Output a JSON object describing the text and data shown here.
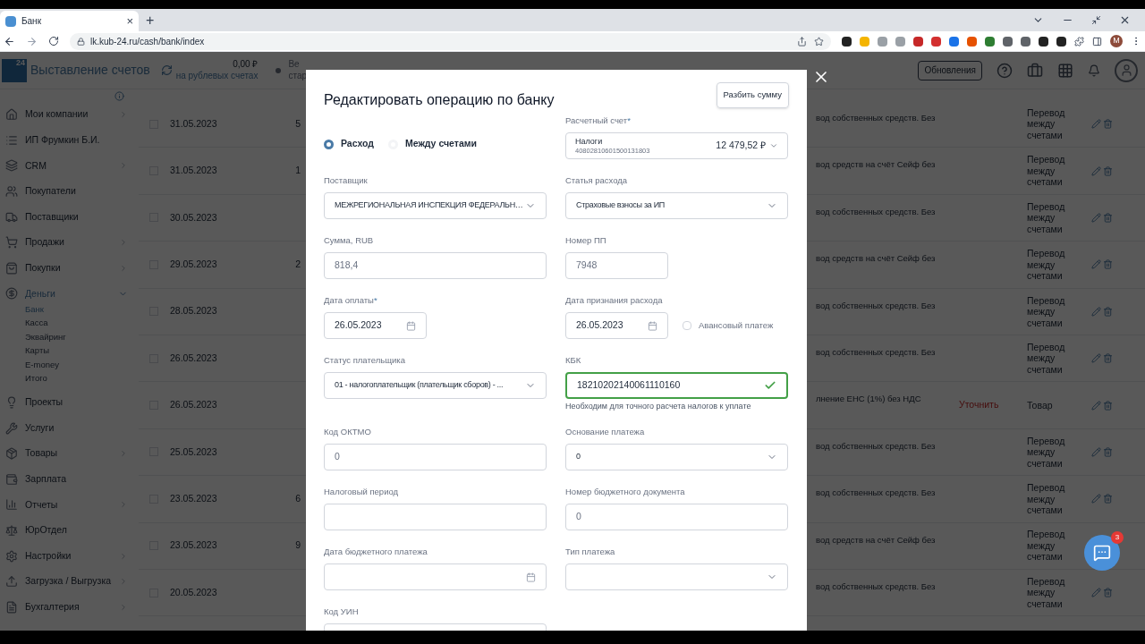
{
  "browser": {
    "tab_title": "Банк",
    "tab_close": "×",
    "new_tab": "+",
    "url": "lk.kub-24.ru/cash/bank/index",
    "profile_letter": "M"
  },
  "header": {
    "logo": "24",
    "title": "Выставление счетов",
    "balance": "0,00 ₽",
    "balance_caption": "на рублевых счетах",
    "cut_line_1": "Ве",
    "cut_line_2": "стар",
    "updates_button": "Обновления"
  },
  "sidebar": {
    "items": [
      {
        "label": "Мои компании",
        "expanded": false
      },
      {
        "label": "ИП Фрумкин Б.И."
      },
      {
        "label": "CRM",
        "expanded": false
      },
      {
        "label": "Покупатели"
      },
      {
        "label": "Поставщики"
      },
      {
        "label": "Продажи",
        "expanded": false
      },
      {
        "label": "Покупки",
        "expanded": false
      },
      {
        "label": "Деньги",
        "expanded": true,
        "children": [
          {
            "label": "Банк",
            "selected": true
          },
          {
            "label": "Касса",
            "selected": false
          },
          {
            "label": "Эквайринг",
            "selected": false
          },
          {
            "label": "Карты",
            "selected": false
          },
          {
            "label": "E-money",
            "selected": false
          },
          {
            "label": "Итого",
            "selected": false
          }
        ]
      },
      {
        "label": "Проекты"
      },
      {
        "label": "Услуги"
      },
      {
        "label": "Товары",
        "expanded": false
      },
      {
        "label": "Зарплата"
      },
      {
        "label": "Отчеты",
        "expanded": false
      },
      {
        "label": "ЮрОтдел"
      },
      {
        "label": "Настройки",
        "expanded": false
      },
      {
        "label": "Загрузка / Выгрузка",
        "expanded": false
      },
      {
        "label": "Бухгалтерия",
        "expanded": false
      }
    ]
  },
  "table": {
    "rows": [
      {
        "checked": false,
        "date": "31.05.2023",
        "amount": "5",
        "description": "вод собственных средств. Без",
        "type": "Перевод между счетами"
      },
      {
        "checked": false,
        "date": "31.05.2023",
        "amount": "1",
        "description": "вод средств на счёт Сейф без",
        "type": "Перевод между счетами"
      },
      {
        "checked": false,
        "date": "30.05.2023",
        "description": "вод собственных средств. Без",
        "type": "Перевод между счетами"
      },
      {
        "checked": false,
        "date": "29.05.2023",
        "amount": "2",
        "description": "вод средств на счёт Сейф без",
        "type": "Перевод между счетами"
      },
      {
        "checked": false,
        "date": "28.05.2023",
        "description": "вод собственных средств. Без",
        "type": "Перевод между счетами"
      },
      {
        "checked": false,
        "date": "26.05.2023",
        "description": "вод собственных средств. Без",
        "type": "Перевод между счетами"
      },
      {
        "checked": false,
        "date": "26.05.2023",
        "description": "лнение ЕНС (1%) без НДС",
        "column_5": "Уточнить",
        "type": "Товар"
      },
      {
        "checked": false,
        "date": "25.05.2023",
        "description": "вод собственных средств. Без",
        "type": "Перевод между счетами"
      },
      {
        "checked": false,
        "date": "23.05.2023",
        "amount": "6",
        "description": "вод собственных средств. Без",
        "type": "Перевод между счетами"
      },
      {
        "checked": false,
        "date": "23.05.2023",
        "amount": "9",
        "description": "вод средств на счёт Сейф без",
        "type": "Перевод между счетами"
      },
      {
        "checked": false,
        "date": "20.05.2023",
        "description": "вод собственных средств. Без",
        "type": "Перевод между счетами"
      }
    ]
  },
  "chat": {
    "badge": "3"
  },
  "modal": {
    "title": "Редактировать операцию по банку",
    "split_button": "Разбить сумму",
    "required_mark": "*",
    "operation_types": [
      {
        "label": "Расход",
        "selected": true
      },
      {
        "label": "Между счетами",
        "selected": false
      }
    ],
    "account": {
      "label": "Расчетный счет",
      "required": true,
      "name": "Налоги",
      "number": "40802810601500131803",
      "balance": "12 479,52 ₽"
    },
    "fields": [
      {
        "kind": "select",
        "label": "Поставщик",
        "value": "МЕЖРЕГИОНАЛЬНАЯ ИНСПЕКЦИЯ ФЕДЕРАЛЬН…"
      },
      {
        "kind": "select",
        "label": "Статья расхода",
        "value": "Страховые взносы за ИП"
      },
      {
        "kind": "input",
        "label": "Сумма, RUB",
        "value": "818,4"
      },
      {
        "kind": "short-input",
        "label": "Номер ПП",
        "value": "7948"
      },
      {
        "kind": "date",
        "label": "Дата оплаты",
        "required": true,
        "value": "26.05.2023"
      },
      {
        "kind": "date",
        "label": "Дата признания расхода",
        "value": "26.05.2023",
        "checkbox": {
          "label": "Авансовый платеж",
          "checked": false
        }
      },
      {
        "kind": "select",
        "label": "Статус плательщика",
        "value": "01 - налогоплательщик (плательщик сборов) - ..."
      },
      {
        "kind": "input",
        "label": "КБК",
        "value": "18210202140061110160",
        "valid": true,
        "hint": "Необходим для точного расчета налогов к уплате"
      },
      {
        "kind": "input",
        "label": "Код ОКТМО",
        "value": "0"
      },
      {
        "kind": "select",
        "label": "Основание платежа",
        "value": "0"
      },
      {
        "kind": "input",
        "label": "Налоговый период"
      },
      {
        "kind": "input",
        "label": "Номер бюджетного документа",
        "value": "0"
      },
      {
        "kind": "wide-date",
        "label": "Дата бюджетного платежа"
      },
      {
        "kind": "select",
        "label": "Тип платежа"
      },
      {
        "kind": "input",
        "label": "Код УИН"
      }
    ]
  }
}
